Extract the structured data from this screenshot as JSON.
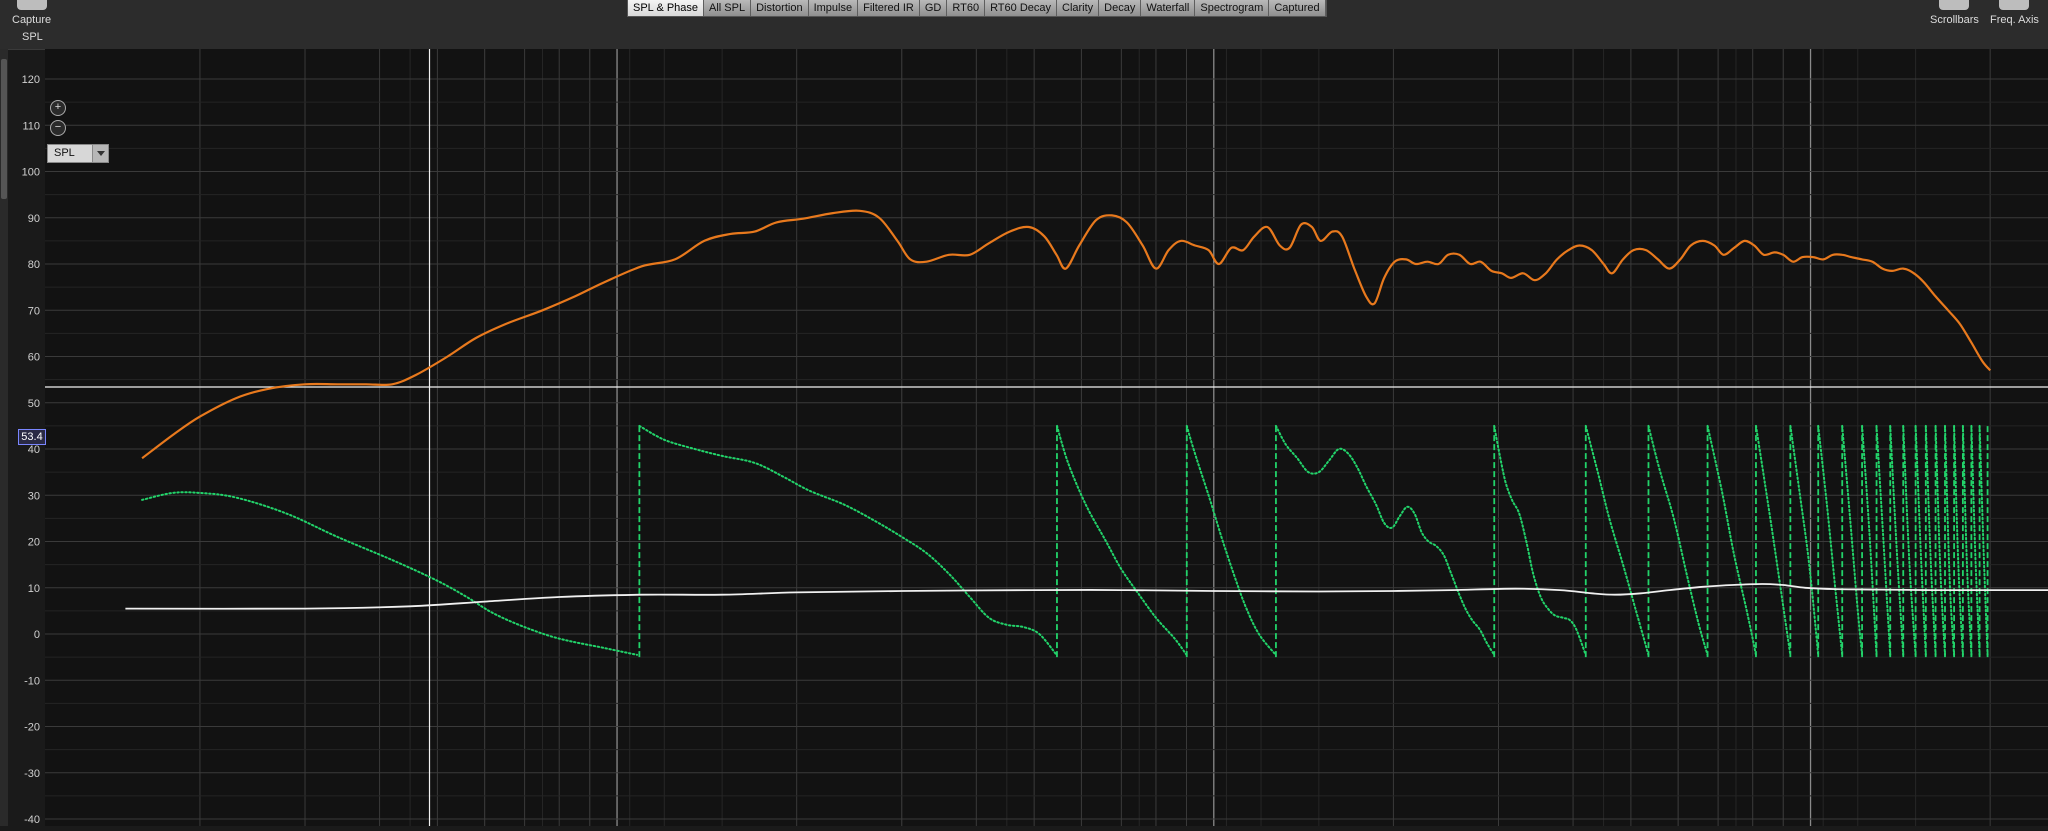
{
  "toolbar": {
    "capture_label": "Capture",
    "scrollbars_label": "Scrollbars",
    "freq_axis_label": "Freq. Axis",
    "tabs": [
      "SPL & Phase",
      "All SPL",
      "Distortion",
      "Impulse",
      "Filtered IR",
      "GD",
      "RT60",
      "RT60 Decay",
      "Clarity",
      "Decay",
      "Waterfall",
      "Spectrogram",
      "Captured"
    ],
    "active_tab": "SPL & Phase"
  },
  "view": {
    "mode_label": "SPL",
    "dropdown_value": "SPL",
    "zoom_in_icon": "zoom-in-icon",
    "zoom_out_icon": "zoom-out-icon"
  },
  "cursor": {
    "value_label": "53.4",
    "y_value": 53.4
  },
  "colors": {
    "spl": "#e8791d",
    "phase": "#22d36a",
    "gd": "#f0f0f0",
    "grid": "#3a3a3a",
    "background": "#121212"
  },
  "chart_data": {
    "type": "line",
    "ylim": [
      -40,
      120
    ],
    "yticks": [
      120,
      110,
      100,
      90,
      80,
      70,
      60,
      50,
      40,
      30,
      20,
      10,
      0,
      -10,
      -20,
      -30,
      -40
    ],
    "x_log": true,
    "xlim_hz": [
      15,
      25000
    ],
    "grid": true,
    "series": [
      {
        "key": "spl",
        "style": "solid",
        "points": [
          [
            16,
            38
          ],
          [
            18,
            43
          ],
          [
            20,
            47
          ],
          [
            23,
            51
          ],
          [
            26,
            53
          ],
          [
            30,
            54
          ],
          [
            34,
            54
          ],
          [
            38,
            54
          ],
          [
            42,
            54
          ],
          [
            46,
            56
          ],
          [
            52,
            60
          ],
          [
            58,
            64
          ],
          [
            65,
            67
          ],
          [
            75,
            70
          ],
          [
            85,
            73
          ],
          [
            95,
            76
          ],
          [
            110,
            79.5
          ],
          [
            125,
            81
          ],
          [
            140,
            85
          ],
          [
            155,
            86.5
          ],
          [
            170,
            87
          ],
          [
            185,
            89
          ],
          [
            205,
            89.8
          ],
          [
            230,
            91
          ],
          [
            255,
            91.5
          ],
          [
            275,
            90
          ],
          [
            295,
            85
          ],
          [
            310,
            81
          ],
          [
            330,
            80.5
          ],
          [
            360,
            82
          ],
          [
            390,
            82
          ],
          [
            420,
            84.5
          ],
          [
            455,
            87
          ],
          [
            490,
            88
          ],
          [
            520,
            86
          ],
          [
            545,
            82
          ],
          [
            565,
            79
          ],
          [
            595,
            84
          ],
          [
            635,
            89.5
          ],
          [
            675,
            90.5
          ],
          [
            715,
            89
          ],
          [
            760,
            84
          ],
          [
            800,
            79
          ],
          [
            840,
            83
          ],
          [
            880,
            85
          ],
          [
            930,
            84
          ],
          [
            980,
            83
          ],
          [
            1020,
            80
          ],
          [
            1070,
            83.5
          ],
          [
            1120,
            83
          ],
          [
            1170,
            86
          ],
          [
            1230,
            88
          ],
          [
            1290,
            84
          ],
          [
            1340,
            83.5
          ],
          [
            1400,
            88.5
          ],
          [
            1460,
            88
          ],
          [
            1510,
            85
          ],
          [
            1580,
            87
          ],
          [
            1640,
            86
          ],
          [
            1720,
            79
          ],
          [
            1800,
            73
          ],
          [
            1860,
            71.5
          ],
          [
            1930,
            77
          ],
          [
            2010,
            80.5
          ],
          [
            2100,
            81
          ],
          [
            2180,
            80
          ],
          [
            2280,
            80.5
          ],
          [
            2380,
            80
          ],
          [
            2470,
            82
          ],
          [
            2580,
            82
          ],
          [
            2690,
            80
          ],
          [
            2800,
            80.5
          ],
          [
            2920,
            78.5
          ],
          [
            3040,
            78
          ],
          [
            3150,
            77
          ],
          [
            3300,
            78
          ],
          [
            3450,
            76.5
          ],
          [
            3600,
            78
          ],
          [
            3760,
            81
          ],
          [
            3930,
            83
          ],
          [
            4100,
            84
          ],
          [
            4300,
            83
          ],
          [
            4500,
            80
          ],
          [
            4650,
            78
          ],
          [
            4850,
            81
          ],
          [
            5050,
            83
          ],
          [
            5300,
            83
          ],
          [
            5550,
            81
          ],
          [
            5800,
            79
          ],
          [
            6050,
            81
          ],
          [
            6300,
            84
          ],
          [
            6600,
            85
          ],
          [
            6900,
            84
          ],
          [
            7150,
            82
          ],
          [
            7450,
            83.5
          ],
          [
            7750,
            85
          ],
          [
            8050,
            84
          ],
          [
            8350,
            82
          ],
          [
            8700,
            82.5
          ],
          [
            9000,
            82
          ],
          [
            9350,
            80.5
          ],
          [
            9700,
            81.5
          ],
          [
            10100,
            81.5
          ],
          [
            10500,
            81
          ],
          [
            10900,
            82
          ],
          [
            11300,
            82
          ],
          [
            11700,
            81.5
          ],
          [
            12200,
            81
          ],
          [
            12700,
            80.5
          ],
          [
            13200,
            79
          ],
          [
            13700,
            78.5
          ],
          [
            14300,
            79
          ],
          [
            14900,
            78
          ],
          [
            15500,
            76
          ],
          [
            16200,
            73
          ],
          [
            17000,
            70
          ],
          [
            17800,
            67
          ],
          [
            18600,
            63
          ],
          [
            19400,
            59
          ],
          [
            20000,
            57
          ]
        ]
      },
      {
        "key": "phase",
        "style": "dotted-wrapped",
        "wrap": [
          -5,
          45
        ],
        "points": [
          [
            16,
            29
          ],
          [
            18,
            30.5
          ],
          [
            20,
            30.5
          ],
          [
            23,
            29.5
          ],
          [
            28,
            26
          ],
          [
            34,
            21
          ],
          [
            42,
            16
          ],
          [
            50,
            11.5
          ],
          [
            56,
            8
          ],
          [
            62,
            4.5
          ],
          [
            70,
            1.5
          ],
          [
            80,
            -1
          ],
          [
            95,
            -3
          ],
          [
            108,
            -4.5
          ],
          [
            109,
            45
          ],
          [
            120,
            42
          ],
          [
            135,
            40
          ],
          [
            150,
            38.5
          ],
          [
            170,
            37
          ],
          [
            190,
            34
          ],
          [
            210,
            31
          ],
          [
            240,
            28
          ],
          [
            270,
            24.5
          ],
          [
            300,
            21
          ],
          [
            330,
            17.5
          ],
          [
            360,
            13
          ],
          [
            390,
            8
          ],
          [
            420,
            3.5
          ],
          [
            450,
            2
          ],
          [
            480,
            1.5
          ],
          [
            510,
            0
          ],
          [
            545,
            -4.5
          ],
          [
            546,
            45
          ],
          [
            570,
            37
          ],
          [
            610,
            28
          ],
          [
            660,
            20
          ],
          [
            700,
            14
          ],
          [
            745,
            9
          ],
          [
            800,
            3.5
          ],
          [
            860,
            -1
          ],
          [
            900,
            -4.5
          ],
          [
            901,
            45
          ],
          [
            930,
            39
          ],
          [
            980,
            30
          ],
          [
            1030,
            21
          ],
          [
            1080,
            13
          ],
          [
            1130,
            6
          ],
          [
            1190,
            0
          ],
          [
            1270,
            -4.5
          ],
          [
            1271,
            45
          ],
          [
            1320,
            41
          ],
          [
            1380,
            38
          ],
          [
            1440,
            35
          ],
          [
            1500,
            35
          ],
          [
            1560,
            37.5
          ],
          [
            1620,
            40
          ],
          [
            1680,
            39
          ],
          [
            1740,
            36
          ],
          [
            1800,
            32
          ],
          [
            1870,
            28
          ],
          [
            1930,
            24
          ],
          [
            1990,
            23
          ],
          [
            2050,
            25.5
          ],
          [
            2110,
            27.5
          ],
          [
            2170,
            26
          ],
          [
            2230,
            22
          ],
          [
            2290,
            20
          ],
          [
            2360,
            19
          ],
          [
            2430,
            17
          ],
          [
            2500,
            13
          ],
          [
            2570,
            9
          ],
          [
            2640,
            5.5
          ],
          [
            2710,
            3
          ],
          [
            2790,
            1
          ],
          [
            2870,
            -2
          ],
          [
            2950,
            -4.5
          ],
          [
            2951,
            45
          ],
          [
            3000,
            40
          ],
          [
            3080,
            33
          ],
          [
            3160,
            29
          ],
          [
            3250,
            26
          ],
          [
            3340,
            20
          ],
          [
            3430,
            13
          ],
          [
            3530,
            8
          ],
          [
            3630,
            5.5
          ],
          [
            3730,
            4
          ],
          [
            3850,
            3.5
          ],
          [
            3950,
            3
          ],
          [
            4050,
            1
          ],
          [
            4200,
            -4.5
          ],
          [
            4201,
            45
          ],
          [
            4400,
            35
          ],
          [
            4600,
            25
          ],
          [
            4850,
            15
          ],
          [
            5100,
            5
          ],
          [
            5350,
            -4.5
          ],
          [
            5351,
            45
          ],
          [
            5600,
            35
          ],
          [
            5900,
            25
          ],
          [
            6200,
            13
          ],
          [
            6500,
            2
          ],
          [
            6720,
            -4.5
          ],
          [
            6721,
            45
          ],
          [
            7100,
            31
          ],
          [
            7450,
            17
          ],
          [
            7850,
            4
          ],
          [
            8100,
            -4.5
          ],
          [
            8101,
            45
          ],
          [
            8400,
            32
          ],
          [
            8700,
            19
          ],
          [
            9000,
            6
          ],
          [
            9250,
            -4.5
          ],
          [
            9251,
            45
          ],
          [
            9600,
            30
          ],
          [
            9950,
            15
          ],
          [
            10300,
            -4.5
          ],
          [
            10301,
            45
          ],
          [
            10650,
            28
          ],
          [
            11000,
            10
          ],
          [
            11300,
            -4.5
          ],
          [
            11301,
            45
          ],
          [
            11650,
            25
          ],
          [
            12000,
            5
          ],
          [
            12200,
            -4.5
          ],
          [
            12201,
            45
          ],
          [
            12550,
            22
          ],
          [
            12900,
            -4.5
          ],
          [
            12901,
            45
          ],
          [
            13250,
            20
          ],
          [
            13600,
            -4.5
          ],
          [
            13601,
            45
          ],
          [
            13950,
            18
          ],
          [
            14300,
            -4.5
          ],
          [
            14301,
            45
          ],
          [
            14650,
            15
          ],
          [
            15000,
            -4.5
          ],
          [
            15001,
            45
          ],
          [
            15300,
            18
          ],
          [
            15600,
            -4.5
          ],
          [
            15601,
            45
          ],
          [
            15900,
            16
          ],
          [
            16200,
            -4.5
          ],
          [
            16201,
            45
          ],
          [
            16500,
            14
          ],
          [
            16800,
            -4.5
          ],
          [
            16801,
            45
          ],
          [
            17100,
            12
          ],
          [
            17400,
            -4.5
          ],
          [
            17401,
            45
          ],
          [
            17700,
            14
          ],
          [
            18000,
            -4.5
          ],
          [
            18001,
            45
          ],
          [
            18300,
            14
          ],
          [
            18600,
            -4.5
          ],
          [
            18601,
            45
          ],
          [
            18900,
            16
          ],
          [
            19200,
            -4.5
          ],
          [
            19201,
            45
          ],
          [
            19500,
            18
          ],
          [
            19800,
            -4.5
          ],
          [
            19801,
            45
          ]
        ]
      },
      {
        "key": "gd",
        "style": "solid",
        "points": [
          [
            15,
            5.5
          ],
          [
            30,
            5.5
          ],
          [
            45,
            6
          ],
          [
            60,
            7
          ],
          [
            80,
            8
          ],
          [
            110,
            8.5
          ],
          [
            150,
            8.5
          ],
          [
            200,
            9
          ],
          [
            300,
            9.3
          ],
          [
            500,
            9.5
          ],
          [
            700,
            9.5
          ],
          [
            1000,
            9.3
          ],
          [
            1500,
            9.2
          ],
          [
            2000,
            9.3
          ],
          [
            2500,
            9.5
          ],
          [
            3200,
            9.8
          ],
          [
            3800,
            9.5
          ],
          [
            4300,
            8.8
          ],
          [
            4700,
            8.5
          ],
          [
            5200,
            8.8
          ],
          [
            5800,
            9.5
          ],
          [
            6600,
            10.2
          ],
          [
            7400,
            10.6
          ],
          [
            8300,
            10.8
          ],
          [
            9000,
            10.6
          ],
          [
            9800,
            10
          ],
          [
            11000,
            9.7
          ],
          [
            13000,
            9.6
          ],
          [
            16000,
            9.5
          ],
          [
            20000,
            9.5
          ],
          [
            25000,
            9.5
          ]
        ]
      }
    ]
  }
}
